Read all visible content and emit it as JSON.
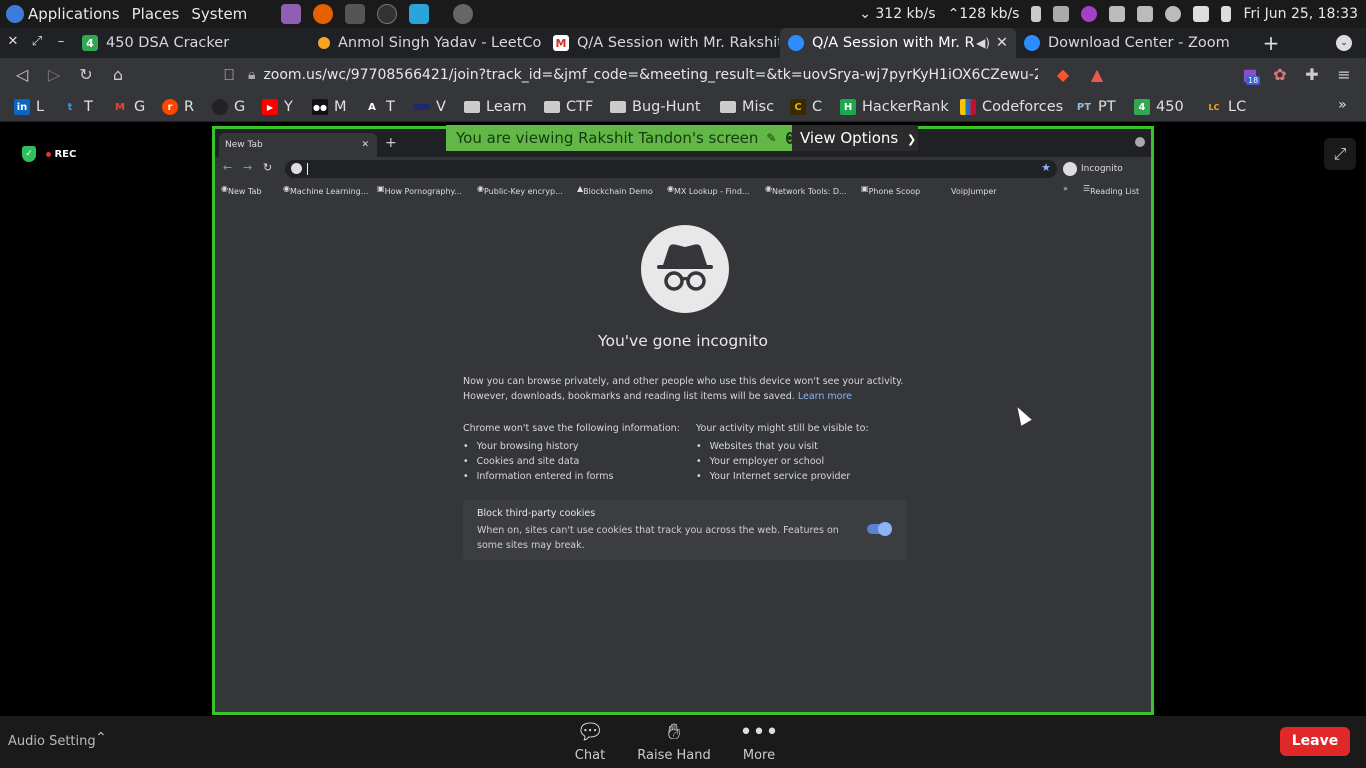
{
  "panel": {
    "menus": [
      "Applications",
      "Places",
      "System"
    ],
    "net_down": "312 kb/s",
    "net_up": "128 kb/s",
    "clock": "Fri Jun 25, 18:33"
  },
  "tabs": [
    {
      "label": "450 DSA Cracker",
      "favicon": "4"
    },
    {
      "label": "Anmol Singh Yadav - LeetCod",
      "favicon": ""
    },
    {
      "label": "Q/A Session with Mr. Rakshit",
      "favicon": "M"
    },
    {
      "label": "Q/A Session with Mr. R",
      "favicon": ""
    },
    {
      "label": "Download Center - Zoom",
      "favicon": ""
    }
  ],
  "toolbar": {
    "url": "zoom.us/wc/97708566421/join?track_id=&jmf_code=&meeting_result=&tk=uovSrya-wj7pyrKyH1iOX6CZewu-2d24...",
    "extension_badge": "18"
  },
  "bookmarks": [
    {
      "label": "L",
      "icon": "in"
    },
    {
      "label": "T",
      "icon": "t"
    },
    {
      "label": "G",
      "icon": "M"
    },
    {
      "label": "R",
      "icon": "r"
    },
    {
      "label": "G",
      "icon": ""
    },
    {
      "label": "Y",
      "icon": "▶"
    },
    {
      "label": "M",
      "icon": "●●"
    },
    {
      "label": "T",
      "icon": "A"
    },
    {
      "label": "V",
      "icon": ""
    },
    {
      "label": "Learn",
      "icon": "folder"
    },
    {
      "label": "CTF",
      "icon": "folder"
    },
    {
      "label": "Bug-Hunt",
      "icon": "folder"
    },
    {
      "label": "Misc",
      "icon": "folder"
    },
    {
      "label": "C",
      "icon": "C"
    },
    {
      "label": "HackerRank",
      "icon": "H"
    },
    {
      "label": "Codeforces",
      "icon": "bars"
    },
    {
      "label": "PT",
      "icon": "PT"
    },
    {
      "label": "450",
      "icon": "4"
    },
    {
      "label": "LC",
      "icon": "LC"
    }
  ],
  "zoom": {
    "rec_label": "REC",
    "banner_text": "You are viewing Rakshit Tandon's screen",
    "view_options": "View Options",
    "audio_setting": "Audio Setting",
    "controls": [
      "Chat",
      "Raise Hand",
      "More"
    ],
    "leave": "Leave"
  },
  "shared": {
    "tab_label": "New Tab",
    "incognito_chip": "Incognito",
    "bookmarks": [
      "New Tab",
      "Machine Learning...",
      "How Pornography...",
      "Public-Key encryp...",
      "Blockchain Demo",
      "MX Lookup - Find...",
      "Network Tools: D...",
      "Phone Scoop",
      "VoipJumper",
      "»",
      "Reading List"
    ],
    "title": "You've gone incognito",
    "intro_line1": "Now you can browse privately, and other people who use this device won't see your activity.",
    "intro_line2": "However, downloads, bookmarks and reading list items will be saved.",
    "learn_more": "Learn more",
    "left_heading": "Chrome won't save the following information:",
    "left_items": [
      "Your browsing history",
      "Cookies and site data",
      "Information entered in forms"
    ],
    "right_heading": "Your activity might still be visible to:",
    "right_items": [
      "Websites that you visit",
      "Your employer or school",
      "Your Internet service provider"
    ],
    "cookie_title": "Block third-party cookies",
    "cookie_desc": "When on, sites can't use cookies that track you across the web. Features on some sites may break."
  }
}
